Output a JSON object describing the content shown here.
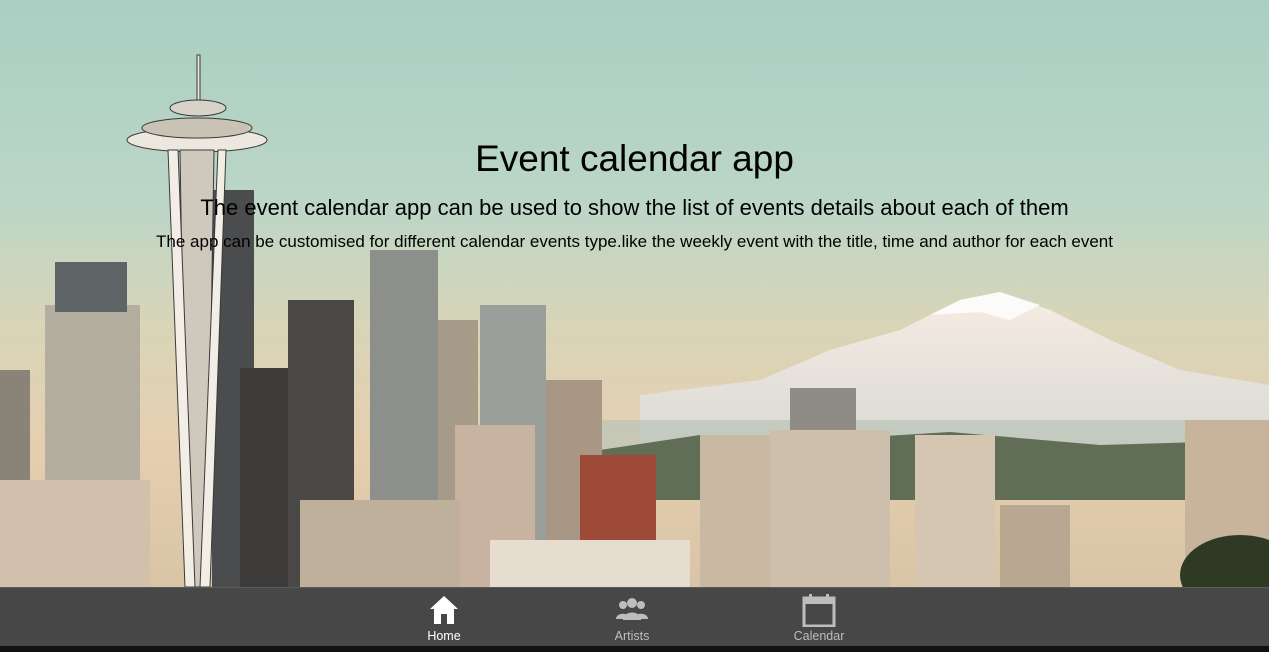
{
  "hero": {
    "title": "Event calendar app",
    "subtitle": "The event calendar app can be used to show the list of events details about each of them",
    "description": "The app can be customised for different calendar events type.like the weekly event with the title, time and author for each event"
  },
  "tab_bar": {
    "tabs": [
      {
        "label": "Home",
        "icon": "home-icon",
        "active": true
      },
      {
        "label": "Artists",
        "icon": "artists-icon",
        "active": false
      },
      {
        "label": "Calendar",
        "icon": "calendar-icon",
        "active": false
      }
    ]
  },
  "colors": {
    "tab_bar_background": "#474747",
    "active_tab": "#ffffff",
    "inactive_tab": "#bdbdbd"
  }
}
